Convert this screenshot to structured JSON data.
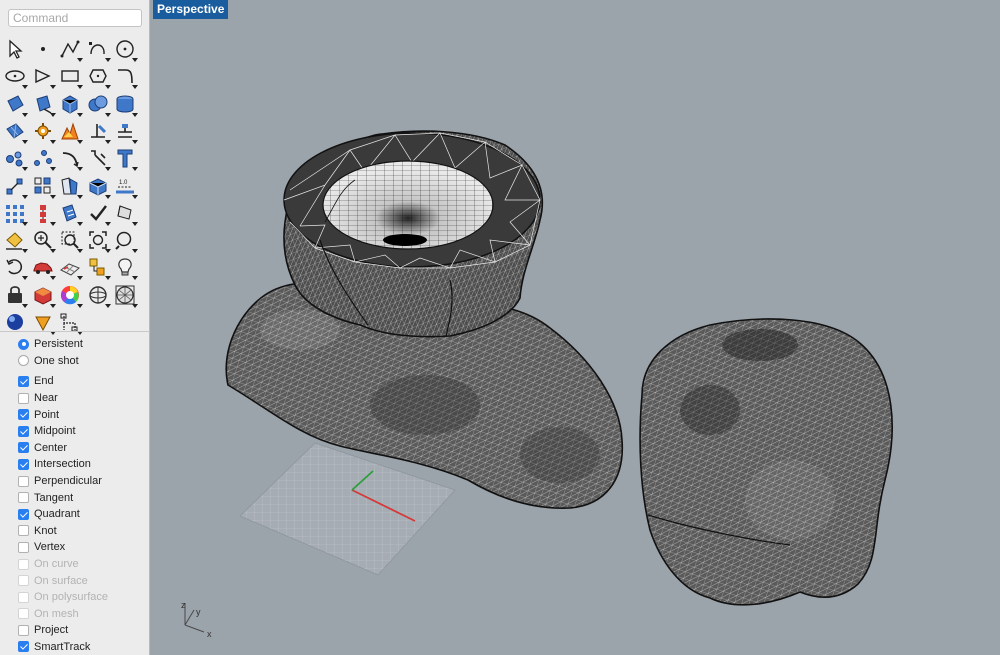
{
  "command": {
    "placeholder": "Command"
  },
  "viewport": {
    "title": "Perspective"
  },
  "tools": [
    {
      "icon": "select-arrow-icon"
    },
    {
      "icon": "point-icon"
    },
    {
      "icon": "polyline-icon"
    },
    {
      "icon": "curve-icon"
    },
    {
      "icon": "circle-icon"
    },
    {
      "icon": "ellipse-icon"
    },
    {
      "icon": "polygon-icon"
    },
    {
      "icon": "rectangle-icon"
    },
    {
      "icon": "cage-icon"
    },
    {
      "icon": "fillet-curve-icon"
    },
    {
      "icon": "surface-from-points-icon"
    },
    {
      "icon": "extrude-surface-icon"
    },
    {
      "icon": "box-solid-icon"
    },
    {
      "icon": "boolean-union-icon"
    },
    {
      "icon": "cylinder-pipe-icon"
    },
    {
      "icon": "mesh-plane-icon"
    },
    {
      "icon": "gear-explode-icon"
    },
    {
      "icon": "explode-icon"
    },
    {
      "icon": "trim-icon"
    },
    {
      "icon": "split-icon"
    },
    {
      "icon": "group-points-icon"
    },
    {
      "icon": "align-points-icon"
    },
    {
      "icon": "bend-icon"
    },
    {
      "icon": "transform-rotate-icon"
    },
    {
      "icon": "text-icon"
    },
    {
      "icon": "move-icon"
    },
    {
      "icon": "array-icon"
    },
    {
      "icon": "mirror-icon"
    },
    {
      "icon": "block-icon"
    },
    {
      "icon": "dimension-icon"
    },
    {
      "icon": "grid-array-icon"
    },
    {
      "icon": "history-icon"
    },
    {
      "icon": "analysis-icon"
    },
    {
      "icon": "check-icon"
    },
    {
      "icon": "shade-icon"
    },
    {
      "icon": "paint-bucket-icon"
    },
    {
      "icon": "zoom-in-icon"
    },
    {
      "icon": "zoom-window-icon"
    },
    {
      "icon": "zoom-extents-icon"
    },
    {
      "icon": "zoom-icon"
    },
    {
      "icon": "rotate-view-icon"
    },
    {
      "icon": "car-render-icon"
    },
    {
      "icon": "grid-plane-icon"
    },
    {
      "icon": "layer-properties-icon"
    },
    {
      "icon": "light-bulb-icon"
    },
    {
      "icon": "lock-icon"
    },
    {
      "icon": "material-box-icon"
    },
    {
      "icon": "color-wheel-icon"
    },
    {
      "icon": "sphere-wire-icon"
    },
    {
      "icon": "mesh-sphere-icon"
    },
    {
      "icon": "render-sphere-icon"
    },
    {
      "icon": "cone-icon"
    },
    {
      "icon": "dimension-tree-icon"
    }
  ],
  "osnap_mode": [
    {
      "label": "Persistent",
      "selected": true
    },
    {
      "label": "One shot",
      "selected": false
    }
  ],
  "osnaps": [
    {
      "label": "End",
      "checked": true,
      "enabled": true
    },
    {
      "label": "Near",
      "checked": false,
      "enabled": true
    },
    {
      "label": "Point",
      "checked": true,
      "enabled": true
    },
    {
      "label": "Midpoint",
      "checked": true,
      "enabled": true
    },
    {
      "label": "Center",
      "checked": true,
      "enabled": true
    },
    {
      "label": "Intersection",
      "checked": true,
      "enabled": true
    },
    {
      "label": "Perpendicular",
      "checked": false,
      "enabled": true
    },
    {
      "label": "Tangent",
      "checked": false,
      "enabled": true
    },
    {
      "label": "Quadrant",
      "checked": true,
      "enabled": true
    },
    {
      "label": "Knot",
      "checked": false,
      "enabled": true
    },
    {
      "label": "Vertex",
      "checked": false,
      "enabled": true
    },
    {
      "label": "On curve",
      "checked": false,
      "enabled": false
    },
    {
      "label": "On surface",
      "checked": false,
      "enabled": false
    },
    {
      "label": "On polysurface",
      "checked": false,
      "enabled": false
    },
    {
      "label": "On mesh",
      "checked": false,
      "enabled": false
    },
    {
      "label": "Project",
      "checked": false,
      "enabled": true
    },
    {
      "label": "SmartTrack",
      "checked": true,
      "enabled": true
    }
  ],
  "axis_labels": {
    "x": "x",
    "y": "y",
    "z": "z"
  },
  "colors": {
    "viewport_bg": "#9ba3ab",
    "tab_bg": "#1a5d9e",
    "accent": "#2a7ff0",
    "mesh_fill": "#4a4a4a",
    "x_axis": "#d33a3a",
    "y_axis": "#2e9e3e"
  }
}
